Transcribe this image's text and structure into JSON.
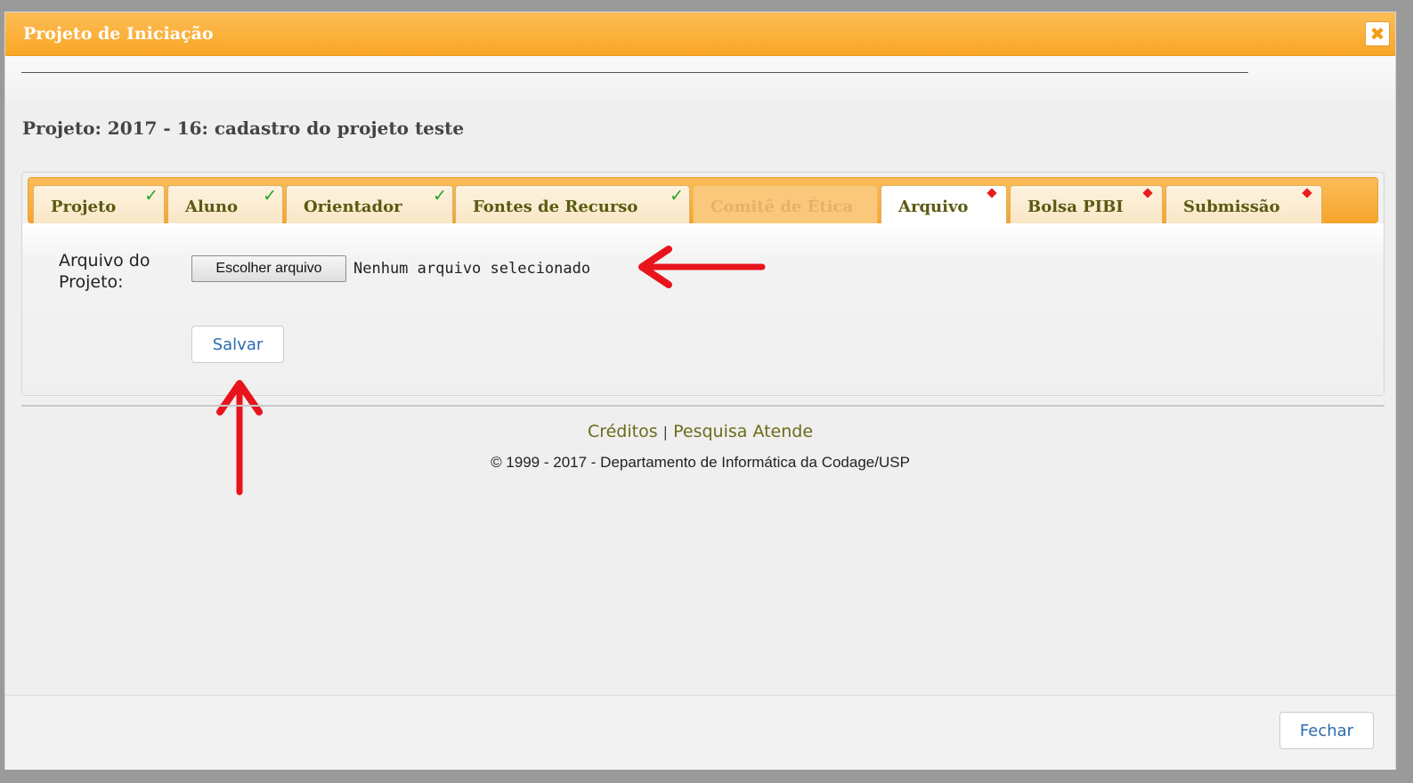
{
  "dialog": {
    "title": "Projeto de Iniciação",
    "close_icon": "close-icon",
    "close_glyph": "✖"
  },
  "project": {
    "title": "Projeto: 2017 - 16: cadastro do projeto teste"
  },
  "tabs": [
    {
      "label": "Projeto",
      "status": "complete",
      "glyph": "✓"
    },
    {
      "label": "Aluno",
      "status": "complete",
      "glyph": "✓"
    },
    {
      "label": "Orientador",
      "status": "complete",
      "glyph": "✓"
    },
    {
      "label": "Fontes de Recurso",
      "status": "complete",
      "glyph": "✓"
    },
    {
      "label": "Comitê de Ética",
      "status": "disabled"
    },
    {
      "label": "Arquivo",
      "status": "pending",
      "active": true
    },
    {
      "label": "Bolsa PIBI",
      "status": "pending"
    },
    {
      "label": "Submissão",
      "status": "pending"
    }
  ],
  "form": {
    "field_label_line1": "Arquivo do",
    "field_label_line2": "Projeto:",
    "file_button_label": "Escolher arquivo",
    "file_status": "Nenhum arquivo selecionado",
    "save_label": "Salvar"
  },
  "footer": {
    "credits_link": "Créditos",
    "separator": "|",
    "support_link": "Pesquisa Atende",
    "copyright": "© 1999 - 2017 - Departamento de Informática da Codage/USP"
  },
  "actions": {
    "close_label": "Fechar"
  },
  "colors": {
    "accent_orange": "#f9a626",
    "check_green": "#1fa51f",
    "pending_red": "#e81d1d",
    "annotation_arrow": "#e8141c"
  }
}
